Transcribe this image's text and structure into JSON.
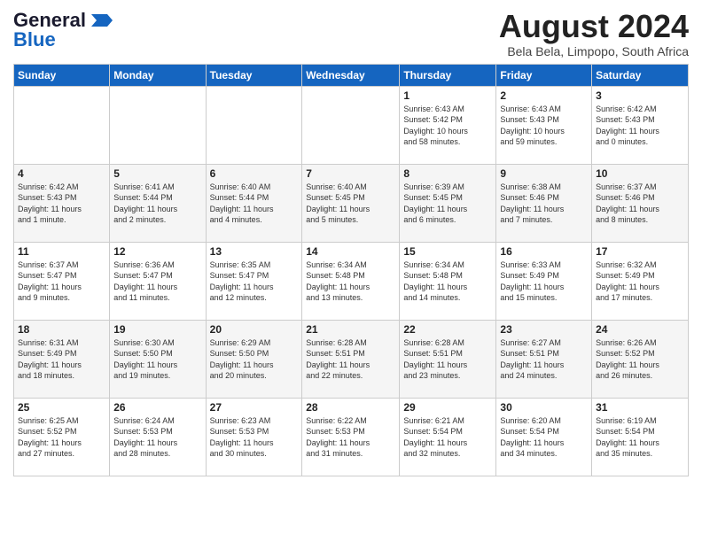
{
  "header": {
    "logo_general": "General",
    "logo_blue": "Blue",
    "month_year": "August 2024",
    "location": "Bela Bela, Limpopo, South Africa"
  },
  "weekdays": [
    "Sunday",
    "Monday",
    "Tuesday",
    "Wednesday",
    "Thursday",
    "Friday",
    "Saturday"
  ],
  "weeks": [
    [
      {
        "day": "",
        "info": ""
      },
      {
        "day": "",
        "info": ""
      },
      {
        "day": "",
        "info": ""
      },
      {
        "day": "",
        "info": ""
      },
      {
        "day": "1",
        "info": "Sunrise: 6:43 AM\nSunset: 5:42 PM\nDaylight: 10 hours\nand 58 minutes."
      },
      {
        "day": "2",
        "info": "Sunrise: 6:43 AM\nSunset: 5:43 PM\nDaylight: 10 hours\nand 59 minutes."
      },
      {
        "day": "3",
        "info": "Sunrise: 6:42 AM\nSunset: 5:43 PM\nDaylight: 11 hours\nand 0 minutes."
      }
    ],
    [
      {
        "day": "4",
        "info": "Sunrise: 6:42 AM\nSunset: 5:43 PM\nDaylight: 11 hours\nand 1 minute."
      },
      {
        "day": "5",
        "info": "Sunrise: 6:41 AM\nSunset: 5:44 PM\nDaylight: 11 hours\nand 2 minutes."
      },
      {
        "day": "6",
        "info": "Sunrise: 6:40 AM\nSunset: 5:44 PM\nDaylight: 11 hours\nand 4 minutes."
      },
      {
        "day": "7",
        "info": "Sunrise: 6:40 AM\nSunset: 5:45 PM\nDaylight: 11 hours\nand 5 minutes."
      },
      {
        "day": "8",
        "info": "Sunrise: 6:39 AM\nSunset: 5:45 PM\nDaylight: 11 hours\nand 6 minutes."
      },
      {
        "day": "9",
        "info": "Sunrise: 6:38 AM\nSunset: 5:46 PM\nDaylight: 11 hours\nand 7 minutes."
      },
      {
        "day": "10",
        "info": "Sunrise: 6:37 AM\nSunset: 5:46 PM\nDaylight: 11 hours\nand 8 minutes."
      }
    ],
    [
      {
        "day": "11",
        "info": "Sunrise: 6:37 AM\nSunset: 5:47 PM\nDaylight: 11 hours\nand 9 minutes."
      },
      {
        "day": "12",
        "info": "Sunrise: 6:36 AM\nSunset: 5:47 PM\nDaylight: 11 hours\nand 11 minutes."
      },
      {
        "day": "13",
        "info": "Sunrise: 6:35 AM\nSunset: 5:47 PM\nDaylight: 11 hours\nand 12 minutes."
      },
      {
        "day": "14",
        "info": "Sunrise: 6:34 AM\nSunset: 5:48 PM\nDaylight: 11 hours\nand 13 minutes."
      },
      {
        "day": "15",
        "info": "Sunrise: 6:34 AM\nSunset: 5:48 PM\nDaylight: 11 hours\nand 14 minutes."
      },
      {
        "day": "16",
        "info": "Sunrise: 6:33 AM\nSunset: 5:49 PM\nDaylight: 11 hours\nand 15 minutes."
      },
      {
        "day": "17",
        "info": "Sunrise: 6:32 AM\nSunset: 5:49 PM\nDaylight: 11 hours\nand 17 minutes."
      }
    ],
    [
      {
        "day": "18",
        "info": "Sunrise: 6:31 AM\nSunset: 5:49 PM\nDaylight: 11 hours\nand 18 minutes."
      },
      {
        "day": "19",
        "info": "Sunrise: 6:30 AM\nSunset: 5:50 PM\nDaylight: 11 hours\nand 19 minutes."
      },
      {
        "day": "20",
        "info": "Sunrise: 6:29 AM\nSunset: 5:50 PM\nDaylight: 11 hours\nand 20 minutes."
      },
      {
        "day": "21",
        "info": "Sunrise: 6:28 AM\nSunset: 5:51 PM\nDaylight: 11 hours\nand 22 minutes."
      },
      {
        "day": "22",
        "info": "Sunrise: 6:28 AM\nSunset: 5:51 PM\nDaylight: 11 hours\nand 23 minutes."
      },
      {
        "day": "23",
        "info": "Sunrise: 6:27 AM\nSunset: 5:51 PM\nDaylight: 11 hours\nand 24 minutes."
      },
      {
        "day": "24",
        "info": "Sunrise: 6:26 AM\nSunset: 5:52 PM\nDaylight: 11 hours\nand 26 minutes."
      }
    ],
    [
      {
        "day": "25",
        "info": "Sunrise: 6:25 AM\nSunset: 5:52 PM\nDaylight: 11 hours\nand 27 minutes."
      },
      {
        "day": "26",
        "info": "Sunrise: 6:24 AM\nSunset: 5:53 PM\nDaylight: 11 hours\nand 28 minutes."
      },
      {
        "day": "27",
        "info": "Sunrise: 6:23 AM\nSunset: 5:53 PM\nDaylight: 11 hours\nand 30 minutes."
      },
      {
        "day": "28",
        "info": "Sunrise: 6:22 AM\nSunset: 5:53 PM\nDaylight: 11 hours\nand 31 minutes."
      },
      {
        "day": "29",
        "info": "Sunrise: 6:21 AM\nSunset: 5:54 PM\nDaylight: 11 hours\nand 32 minutes."
      },
      {
        "day": "30",
        "info": "Sunrise: 6:20 AM\nSunset: 5:54 PM\nDaylight: 11 hours\nand 34 minutes."
      },
      {
        "day": "31",
        "info": "Sunrise: 6:19 AM\nSunset: 5:54 PM\nDaylight: 11 hours\nand 35 minutes."
      }
    ]
  ]
}
